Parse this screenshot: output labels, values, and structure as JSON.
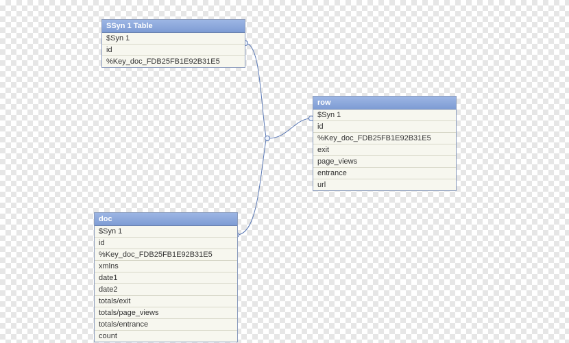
{
  "entities": {
    "ssyn": {
      "title": "SSyn 1 Table",
      "fields": [
        "$Syn 1",
        "id",
        "%Key_doc_FDB25FB1E92B31E5"
      ]
    },
    "row": {
      "title": "row",
      "fields": [
        "$Syn 1",
        "id",
        "%Key_doc_FDB25FB1E92B31E5",
        "exit",
        "page_views",
        "entrance",
        "url"
      ]
    },
    "doc": {
      "title": "doc",
      "fields": [
        "$Syn 1",
        "id",
        "%Key_doc_FDB25FB1E92B31E5",
        "xmlns",
        "date1",
        "date2",
        "totals/exit",
        "totals/page_views",
        "totals/entrance",
        "count"
      ]
    }
  }
}
